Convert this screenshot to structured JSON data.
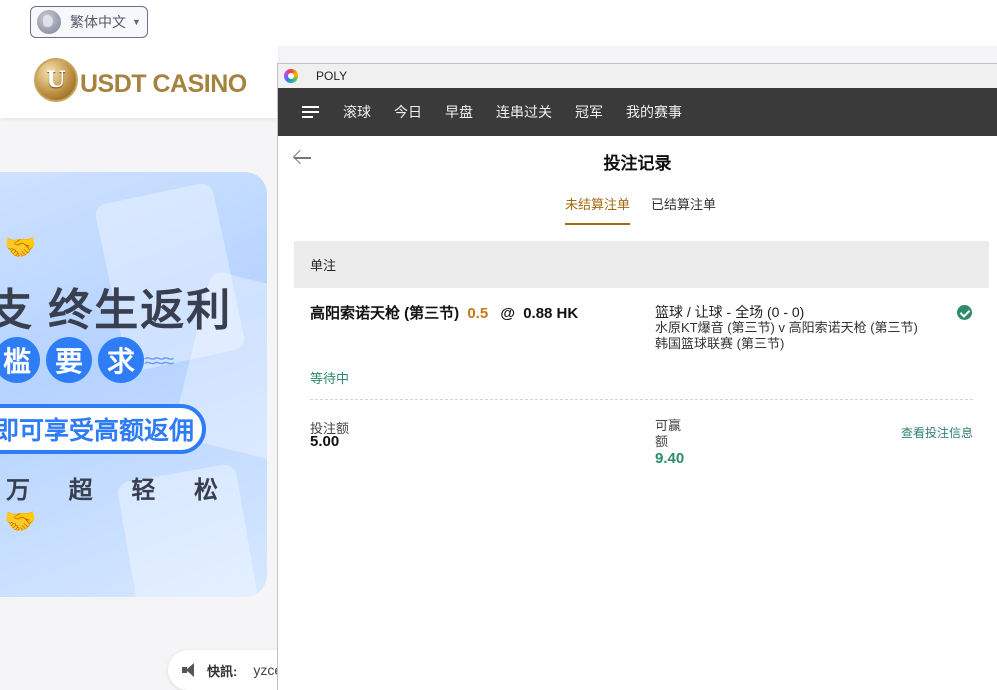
{
  "top_bar": {
    "language": "繁体中文"
  },
  "casino": {
    "logo_letter": "U",
    "logo_text": "USDT CASINO"
  },
  "banner": {
    "line1": "支 终生返利",
    "line2_chars": [
      "槛",
      "要",
      "求"
    ],
    "line3": "即可享受高额返佣",
    "line4": "万 超 轻 松"
  },
  "ticker": {
    "label": "快訊:",
    "text": "yzce"
  },
  "window": {
    "title": "POLY",
    "nav": [
      "滚球",
      "今日",
      "早盘",
      "连串过关",
      "冠军",
      "我的赛事"
    ],
    "page_title": "投注记录",
    "tabs": {
      "unsettled": "未结算注单",
      "settled": "已结算注单"
    },
    "section": "单注",
    "bet": {
      "selection": "高阳索诺天枪 (第三节)",
      "handicap": "0.5",
      "at": "@",
      "odds": "0.88 HK",
      "market": "篮球 / 让球 - 全场 (0 - 0)",
      "match": "水原KT爆音 (第三节) v 高阳索诺天枪 (第三节)",
      "league": "韩国篮球联赛 (第三节)",
      "status": "等待中",
      "stake_label": "投注额",
      "stake": "5.00",
      "win_label": "可赢额",
      "win": "9.40",
      "detail_link": "查看投注信息"
    }
  },
  "colors": {
    "accent_gold": "#a36a10",
    "green": "#2e8c6a",
    "nav_bg": "#3a3a3a",
    "banner_blue": "#2f7df6"
  }
}
